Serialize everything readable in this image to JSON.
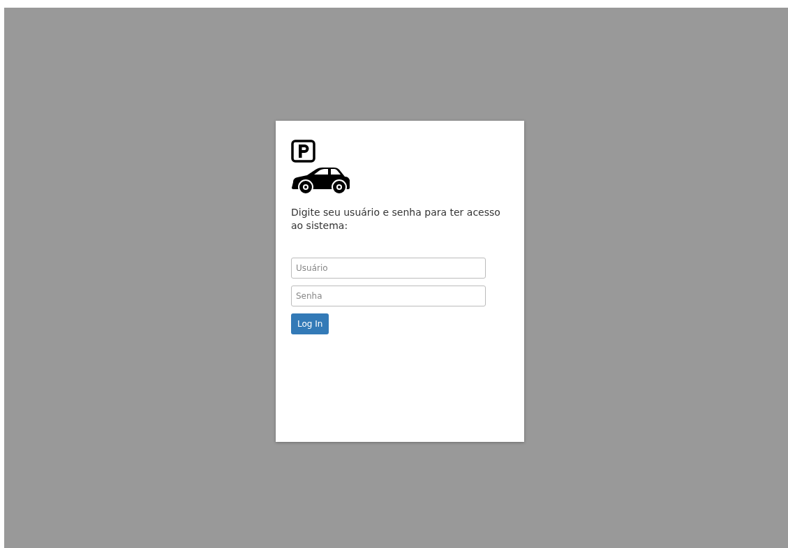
{
  "login": {
    "instructions": "Digite seu usuário e senha para ter acesso ao sistema:",
    "username": {
      "placeholder": "Usuário"
    },
    "password": {
      "placeholder": "Senha"
    },
    "button": "Log In"
  }
}
